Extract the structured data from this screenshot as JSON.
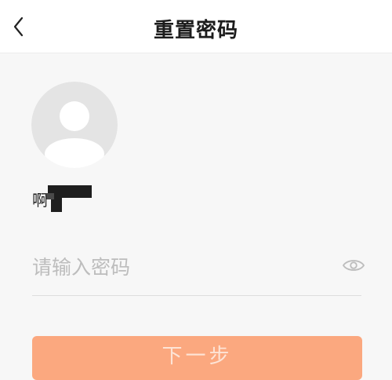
{
  "header": {
    "title": "重置密码",
    "back_icon": "chevron-left-icon"
  },
  "profile": {
    "avatar_icon": "default-avatar-icon",
    "username": "啊"
  },
  "password": {
    "placeholder": "请输入密码",
    "value": "",
    "toggle_icon": "eye-icon"
  },
  "actions": {
    "next_label": "下一步"
  },
  "colors": {
    "background": "#f7f7f7",
    "header_bg": "#ffffff",
    "accent": "#fba87f",
    "placeholder": "#bdbdbd"
  }
}
